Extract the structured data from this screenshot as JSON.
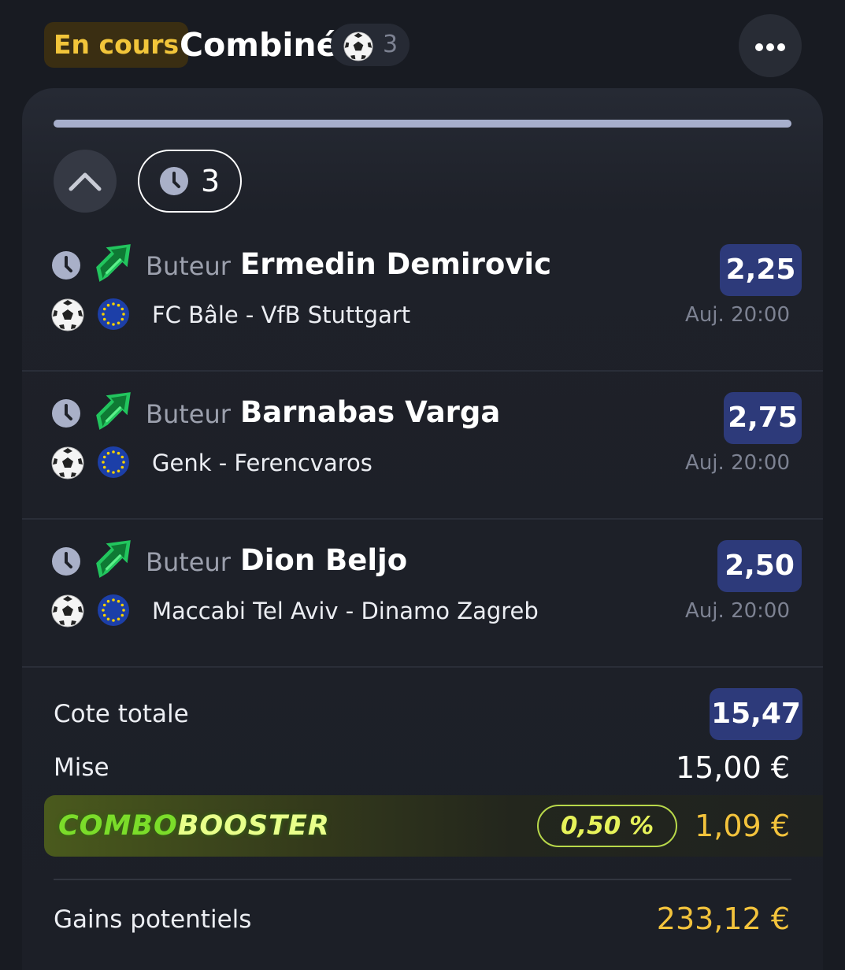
{
  "header": {
    "status": "En cours",
    "title": "Combiné",
    "sport_icon": "soccer-ball-icon",
    "sport_count": "3",
    "menu_icon": "more-dots-icon"
  },
  "card": {
    "progress": 0,
    "collapse_icon": "chevron-up-icon",
    "pending_count": "3"
  },
  "selections": [
    {
      "market": "Buteur",
      "player": "Ermedin Demirovic",
      "odds": "2,25",
      "match": "FC Bâle - VfB Stuttgart",
      "time": "Auj. 20:00"
    },
    {
      "market": "Buteur",
      "player": "Barnabas Varga",
      "odds": "2,75",
      "match": "Genk - Ferencvaros",
      "time": "Auj. 20:00"
    },
    {
      "market": "Buteur",
      "player": "Dion Beljo",
      "odds": "2,50",
      "match": "Maccabi Tel Aviv - Dinamo Zagreb",
      "time": "Auj. 20:00"
    }
  ],
  "summary": {
    "total_odds_label": "Cote totale",
    "total_odds": "15,47",
    "stake_label": "Mise",
    "stake": "15,00 €",
    "booster_logo_part1": "COMBO",
    "booster_logo_part2": "BOOSTER",
    "booster_percent": "0,50 %",
    "booster_amount": "1,09 €",
    "gains_label": "Gains potentiels",
    "gains": "233,12 €"
  },
  "colors": {
    "background": "#181b22",
    "odds_pill": "#2d3a7a",
    "status_text": "#f2c53a",
    "gains": "#f3c33c",
    "boost_green": "#22c55e"
  }
}
